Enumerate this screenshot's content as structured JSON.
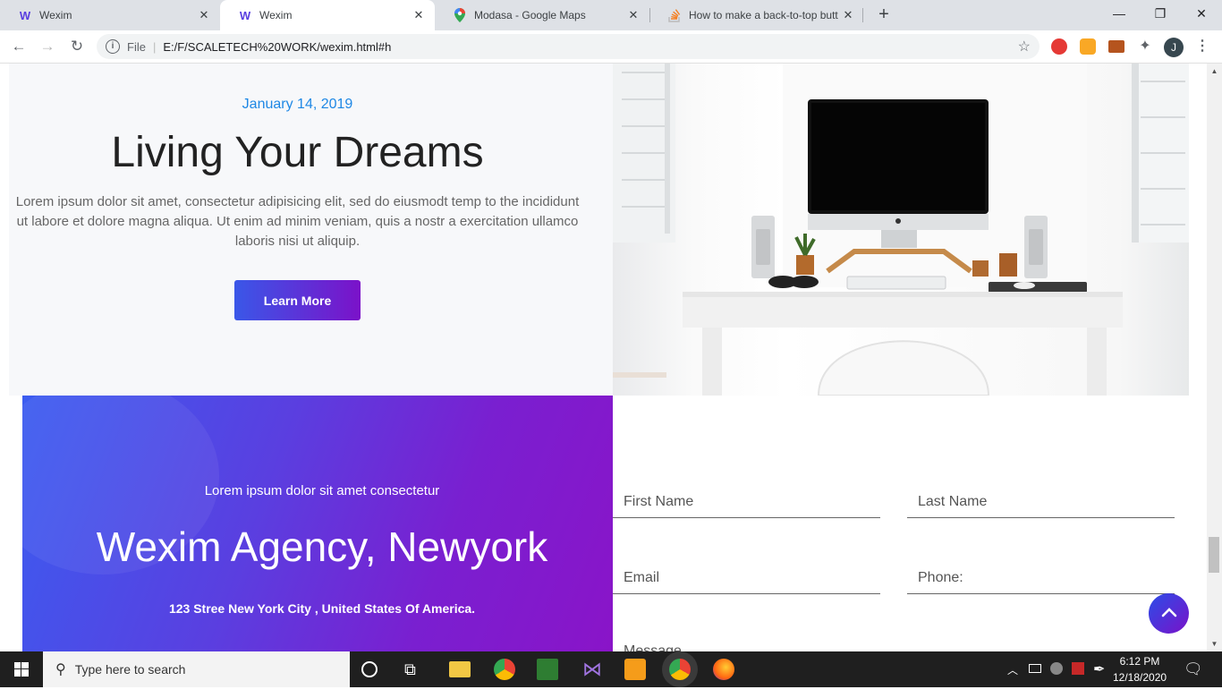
{
  "browser": {
    "tabs": [
      {
        "title": "Wexim",
        "favicon": "wexim-w-logo",
        "active": false
      },
      {
        "title": "Wexim",
        "favicon": "wexim-w-logo",
        "active": true
      },
      {
        "title": "Modasa - Google Maps",
        "favicon": "google-maps-pin",
        "active": false
      },
      {
        "title": "How to make a back-to-top butt",
        "favicon": "stackoverflow-logo",
        "active": false
      }
    ],
    "new_tab": "+",
    "file_label": "File",
    "url": "E:/F/SCALETECH%20WORK/wexim.html#h",
    "profile_initial": "J"
  },
  "hero": {
    "date": "January 14, 2019",
    "title": "Living Your Dreams",
    "body": "Lorem ipsum dolor sit amet, consectetur adipisicing elit, sed do eiusmodt temp to the incididunt ut labore et dolore magna aliqua. Ut enim ad minim veniam, quis a nostr a exercitation ullamco laboris nisi ut aliquip.",
    "button": "Learn More"
  },
  "office": {
    "subtitle": "Lorem ipsum dolor sit amet consectetur",
    "title": "Wexim Agency, Newyork",
    "address": "123 Stree New York City , United States Of America."
  },
  "form": {
    "first_name": "First Name",
    "last_name": "Last Name",
    "email": "Email",
    "phone": "Phone:",
    "message": "Message"
  },
  "taskbar": {
    "search_placeholder": "Type here to search",
    "time": "6:12 PM",
    "date": "12/18/2020"
  },
  "colors": {
    "accent_blue": "#1e88e5",
    "gradient_start": "#3a57e8",
    "gradient_end": "#7b12c9"
  }
}
